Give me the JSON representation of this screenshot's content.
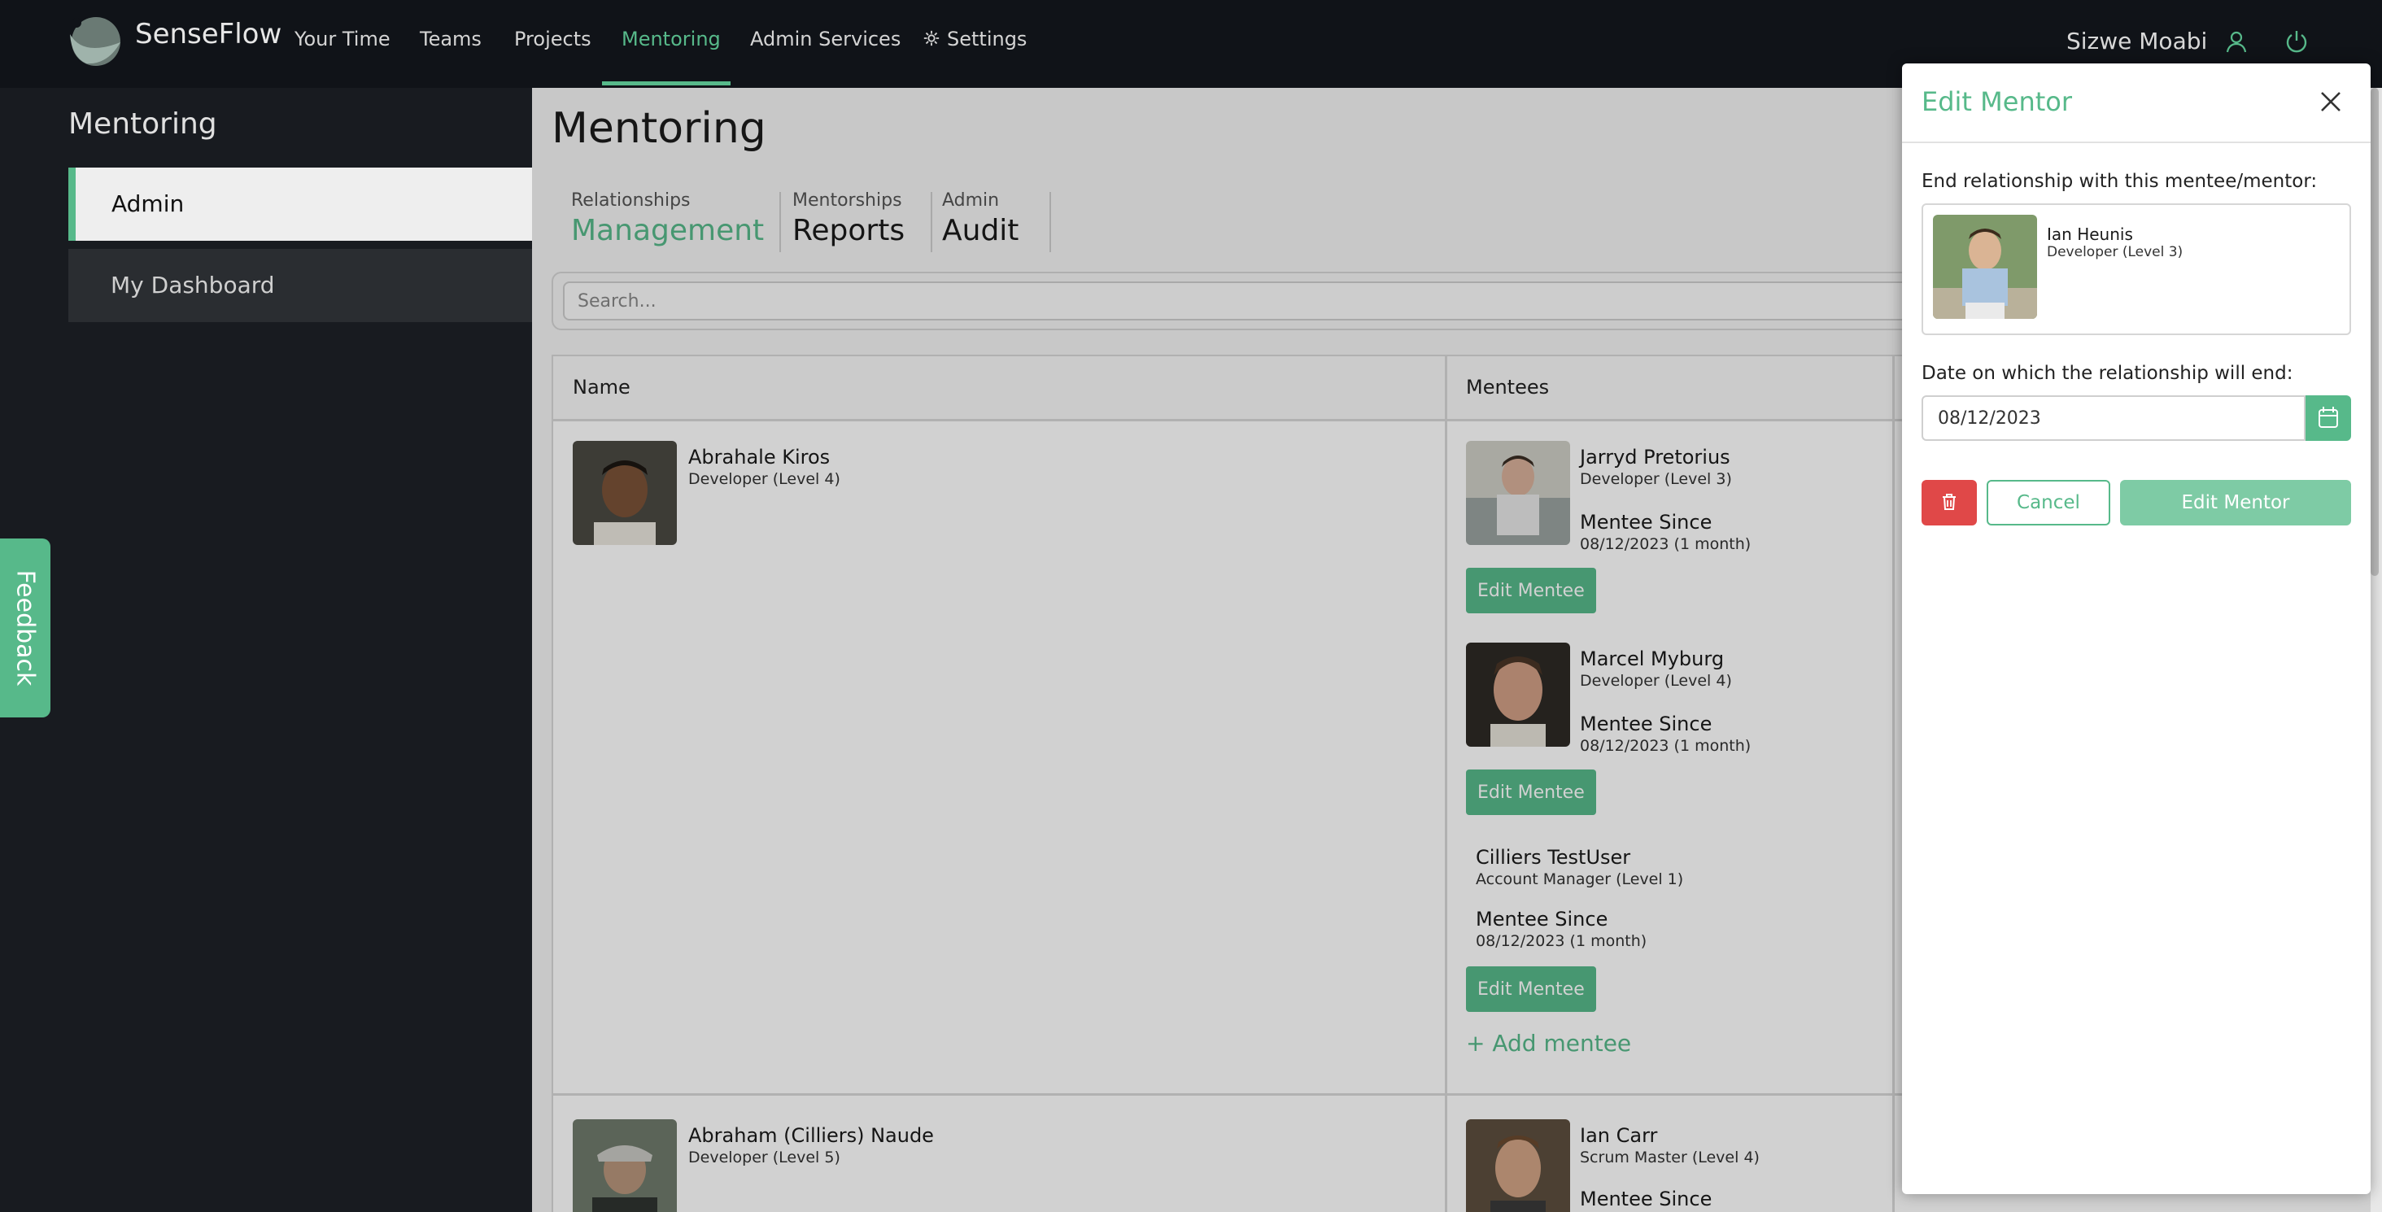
{
  "navbar": {
    "brand": "SenseFlow",
    "items": [
      {
        "label": "Your Time"
      },
      {
        "label": "Teams"
      },
      {
        "label": "Projects"
      },
      {
        "label": "Mentoring"
      },
      {
        "label": "Admin Services"
      },
      {
        "label": "Settings"
      }
    ],
    "active": "Mentoring",
    "user": "Sizwe Moabi",
    "accent_color": "#57b98a",
    "icons": [
      "gear-icon",
      "user-icon",
      "power-icon"
    ]
  },
  "sidebar": {
    "title": "Mentoring",
    "items": [
      {
        "label": "Admin"
      },
      {
        "label": "My Dashboard"
      }
    ]
  },
  "feedback": {
    "label": "Feedback"
  },
  "main": {
    "title": "Mentoring",
    "tabs": [
      {
        "small": "Relationships",
        "big": "Management"
      },
      {
        "small": "Mentorships",
        "big": "Reports"
      },
      {
        "small": "Admin",
        "big": "Audit"
      }
    ],
    "search_placeholder": "Search...",
    "columns": [
      "Name",
      "Mentees"
    ],
    "rows": [
      {
        "mentor": {
          "name": "Abrahale Kiros",
          "role": "Developer (Level 4)"
        },
        "mentees": [
          {
            "name": "Jarryd Pretorius",
            "role": "Developer (Level 3)",
            "since_label": "Mentee Since",
            "since": "08/12/2023 (1 month)",
            "button": "Edit Mentee"
          },
          {
            "name": "Marcel Myburg",
            "role": "Developer (Level 4)",
            "since_label": "Mentee Since",
            "since": "08/12/2023 (1 month)",
            "button": "Edit Mentee"
          },
          {
            "name": "Cilliers TestUser",
            "role": "Account Manager (Level 1)",
            "since_label": "Mentee Since",
            "since": "08/12/2023 (1 month)",
            "button": "Edit Mentee"
          }
        ],
        "add_label": "+ Add mentee"
      },
      {
        "mentor": {
          "name": "Abraham (Cilliers) Naude",
          "role": "Developer (Level 5)"
        },
        "mentees": [
          {
            "name": "Ian Carr",
            "role": "Scrum Master (Level 4)",
            "since_label": "Mentee Since"
          }
        ]
      }
    ]
  },
  "panel": {
    "title": "Edit Mentor",
    "end_label": "End relationship with this mentee/mentor:",
    "mentor": {
      "name": "Ian Heunis",
      "role": "Developer (Level 3)"
    },
    "date_label": "Date on which the relationship will end:",
    "date_value": "08/12/2023",
    "cancel": "Cancel",
    "submit": "Edit Mentor",
    "delete_color": "#e04848"
  }
}
